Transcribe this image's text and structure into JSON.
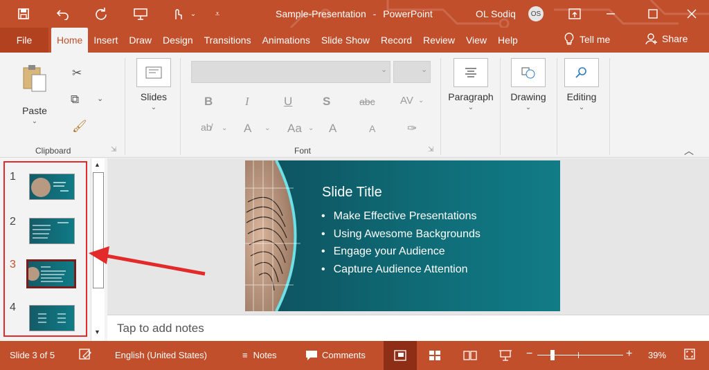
{
  "window": {
    "document_name": "Sample-Presentation",
    "separator": "-",
    "app_name": "PowerPoint",
    "user_name": "OL Sodiq",
    "user_initials": "OS"
  },
  "tabs": [
    {
      "label": "File"
    },
    {
      "label": "Home"
    },
    {
      "label": "Insert"
    },
    {
      "label": "Draw"
    },
    {
      "label": "Design"
    },
    {
      "label": "Transitions"
    },
    {
      "label": "Animations"
    },
    {
      "label": "Slide Show"
    },
    {
      "label": "Record"
    },
    {
      "label": "Review"
    },
    {
      "label": "View"
    },
    {
      "label": "Help"
    }
  ],
  "tell_me": "Tell me",
  "share": "Share",
  "ribbon": {
    "clipboard": {
      "paste": "Paste",
      "label": "Clipboard"
    },
    "slides": "Slides",
    "font_label": "Font",
    "font_buttons": {
      "bold": "B",
      "italic": "I",
      "underline": "U",
      "shadow": "S",
      "strike": "abc",
      "spacing": "AV",
      "case": "Aa",
      "font_color": "A",
      "grow": "A",
      "shrink": "A"
    },
    "paragraph": "Paragraph",
    "drawing": "Drawing",
    "editing": "Editing"
  },
  "thumbnails": [
    {
      "num": "1"
    },
    {
      "num": "2"
    },
    {
      "num": "3"
    },
    {
      "num": "4"
    }
  ],
  "slide": {
    "title": "Slide Title",
    "bullets": [
      "Make Effective Presentations",
      "Using Awesome Backgrounds",
      "Engage your Audience",
      "Capture Audience Attention"
    ]
  },
  "notes_placeholder": "Tap to add notes",
  "status": {
    "slide_info": "Slide 3 of 5",
    "language": "English (United States)",
    "notes": "Notes",
    "comments": "Comments",
    "zoom_minus": "−",
    "zoom_plus": "+",
    "zoom_percent": "39%"
  },
  "colors": {
    "accent": "#c14f2c",
    "selected_thumb_border": "#7a1c1c",
    "annotation": "#e22a2a"
  }
}
